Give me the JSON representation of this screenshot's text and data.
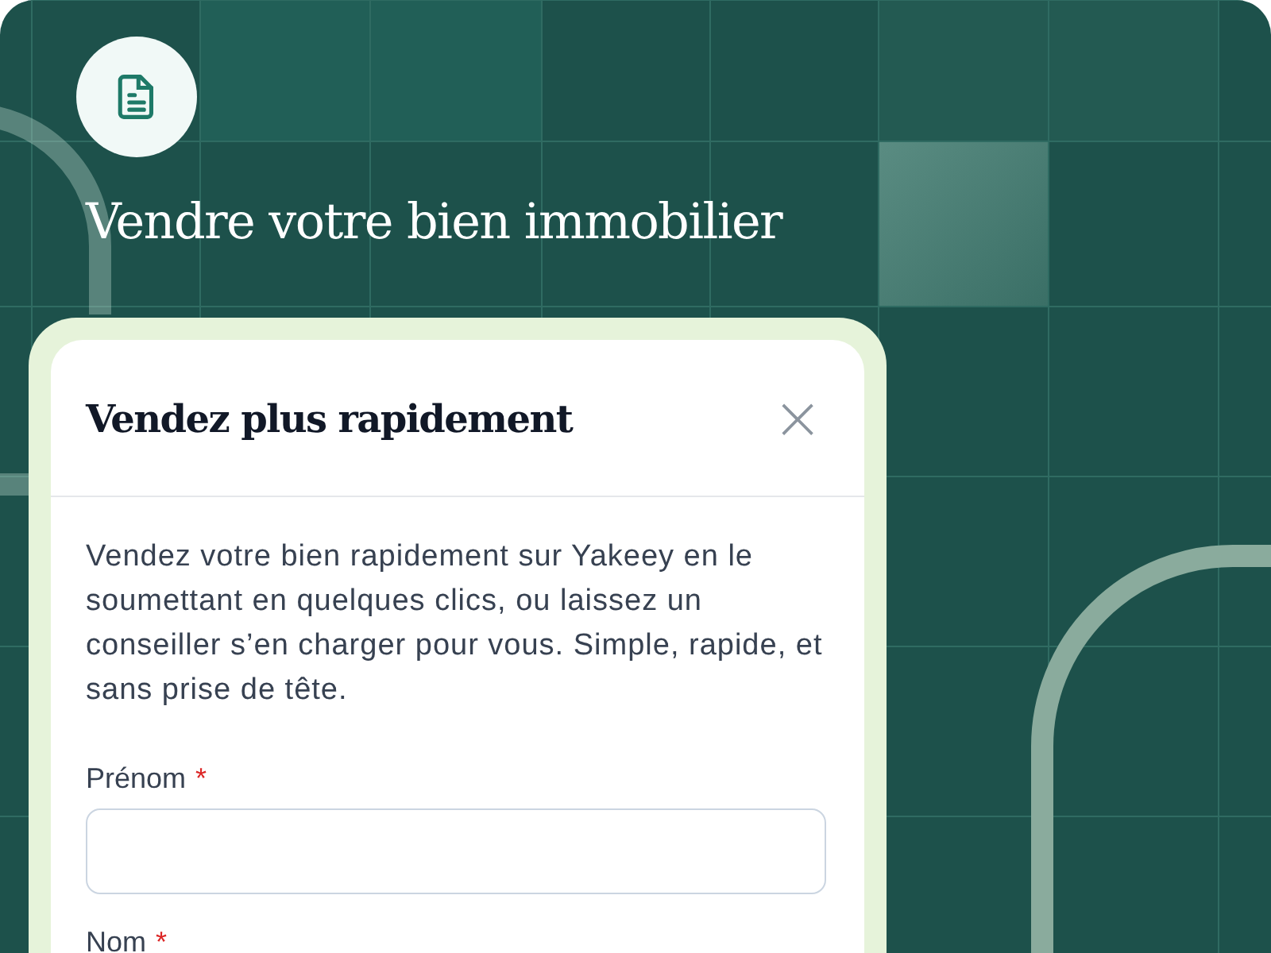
{
  "header": {
    "title": "Vendre votre bien immobilier"
  },
  "dialog": {
    "title": "Vendez plus rapidement",
    "close": "×",
    "intro": "Vendez votre bien rapidement sur Yakeey en le soumettant en quelques clics, ou laissez un conseiller s’en charger pour vous. Simple, rapide, et sans prise de tête.",
    "fields": [
      {
        "label": "Prénom",
        "required_mark": "*",
        "kind": "input"
      },
      {
        "label": "Nom",
        "required_mark": "*",
        "kind": "cut"
      }
    ]
  }
}
